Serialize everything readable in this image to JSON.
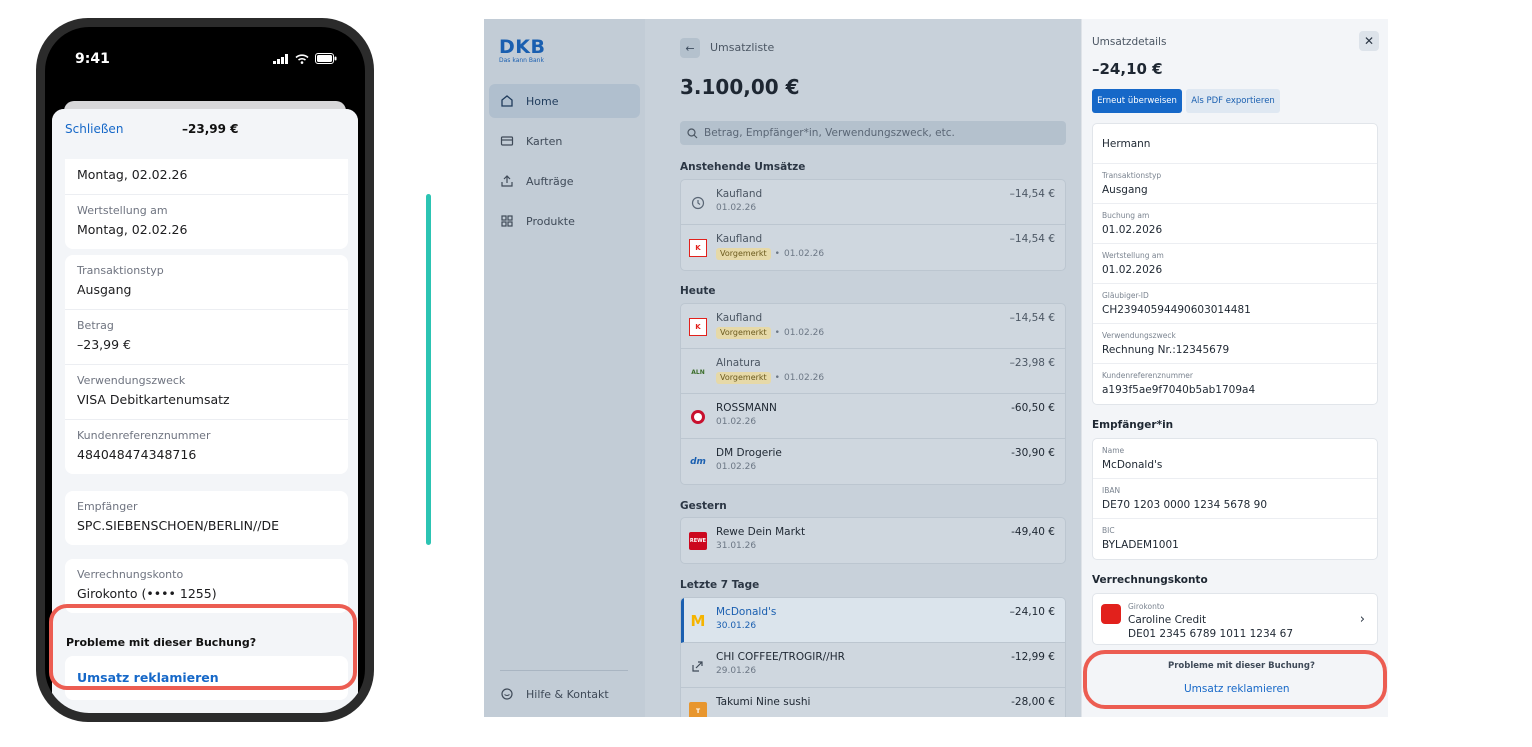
{
  "phone": {
    "status_time": "9:41",
    "header": {
      "close_label": "Schließen",
      "amount": "–23,99 €"
    },
    "card1": {
      "date_value": "Montag, 02.02.26",
      "valuta_label": "Wertstellung am",
      "valuta_value": "Montag, 02.02.26"
    },
    "card2": [
      {
        "label": "Transaktionstyp",
        "value": "Ausgang"
      },
      {
        "label": "Betrag",
        "value": "–23,99 €"
      },
      {
        "label": "Verwendungszweck",
        "value": "VISA Debitkartenumsatz"
      },
      {
        "label": "Kundenreferenznummer",
        "value": "484048474348716"
      }
    ],
    "recipient": {
      "label": "Empfänger",
      "value": "SPC.SIEBENSCHOEN/BERLIN//DE"
    },
    "clearing": {
      "label": "Verrechnungskonto",
      "value": "Girokonto (•••• 1255)"
    },
    "problem_title": "Probleme mit dieser Buchung?",
    "reklam_label": "Umsatz reklamieren"
  },
  "app": {
    "logo": {
      "main": "DKB",
      "sub": "Das kann Bank"
    },
    "nav": [
      {
        "label": "Home",
        "icon": "home-icon"
      },
      {
        "label": "Karten",
        "icon": "card-icon"
      },
      {
        "label": "Aufträge",
        "icon": "upload-icon"
      },
      {
        "label": "Produkte",
        "icon": "grid-icon"
      }
    ],
    "help_label": "Hilfe & Kontakt",
    "main": {
      "back_title": "Umsatzliste",
      "balance": "3.100,00 €",
      "search_placeholder": "Betrag, Empfänger*in, Verwendungszweck, etc.",
      "sections": [
        {
          "title": "Anstehende Umsätze",
          "items": [
            {
              "name": "Kaufland",
              "date": "01.02.26",
              "amount": "–14,54 €",
              "logo": "clock"
            },
            {
              "name": "Kaufland",
              "badge": "Vorgemerkt",
              "date": "01.02.26",
              "amount": "–14,54 €",
              "logo": "kaufland"
            }
          ]
        },
        {
          "title": "Heute",
          "items": [
            {
              "name": "Kaufland",
              "badge": "Vorgemerkt",
              "date": "01.02.26",
              "amount": "–14,54 €",
              "logo": "kaufland"
            },
            {
              "name": "Alnatura",
              "badge": "Vorgemerkt",
              "date": "01.02.26",
              "amount": "–23,98 €",
              "logo": "alnatura"
            },
            {
              "name": "ROSSMANN",
              "date": "01.02.26",
              "amount": "-60,50 €",
              "logo": "rossmann"
            },
            {
              "name": "DM Drogerie",
              "date": "01.02.26",
              "amount": "-30,90 €",
              "logo": "dm"
            }
          ]
        },
        {
          "title": "Gestern",
          "items": [
            {
              "name": "Rewe Dein Markt",
              "date": "31.01.26",
              "amount": "-49,40 €",
              "logo": "rewe"
            }
          ]
        },
        {
          "title": "Letzte 7 Tage",
          "items": [
            {
              "name": "McDonald's",
              "date": "30.01.26",
              "amount": "–24,10 €",
              "logo": "mcdonalds",
              "selected": true
            },
            {
              "name": "CHI COFFEE/TROGIR//HR",
              "date": "29.01.26",
              "amount": "-12,99 €",
              "logo": "share"
            },
            {
              "name": "Takumi Nine sushi",
              "date": "",
              "amount": "-28,00 €",
              "logo": "takumi"
            }
          ]
        }
      ]
    },
    "details": {
      "title": "Umsatzdetails",
      "amount": "–24,10 €",
      "btn_transfer": "Erneut überweisen",
      "btn_pdf": "Als PDF exportieren",
      "payee": "Hermann",
      "rows": [
        {
          "label": "Transaktionstyp",
          "value": "Ausgang"
        },
        {
          "label": "Buchung am",
          "value": "01.02.2026"
        },
        {
          "label": "Wertstellung am",
          "value": "01.02.2026"
        },
        {
          "label": "Gläubiger-ID",
          "value": "CH23940594490603014481"
        },
        {
          "label": "Verwendungszweck",
          "value": "Rechnung Nr.:12345679"
        },
        {
          "label": "Kundenreferenznummer",
          "value": "a193f5ae9f7040b5ab1709a4"
        }
      ],
      "recipient_title": "Empfänger*in",
      "recipient_rows": [
        {
          "label": "Name",
          "value": "McDonald's"
        },
        {
          "label": "IBAN",
          "value": "DE70 1203 0000 1234 5678 90"
        },
        {
          "label": "BIC",
          "value": "BYLADEM1001"
        }
      ],
      "clearing_title": "Verrechnungskonto",
      "account": {
        "type": "Girokonto",
        "name": "Caroline Credit",
        "iban": "DE01 2345 6789 1011 1234 67"
      },
      "problem_title": "Probleme mit dieser Buchung?",
      "reklam_label": "Umsatz reklamieren"
    }
  },
  "colors": {
    "accent": "#1668c8",
    "highlight": "#ec5d52",
    "teal": "#2cc4b3"
  }
}
